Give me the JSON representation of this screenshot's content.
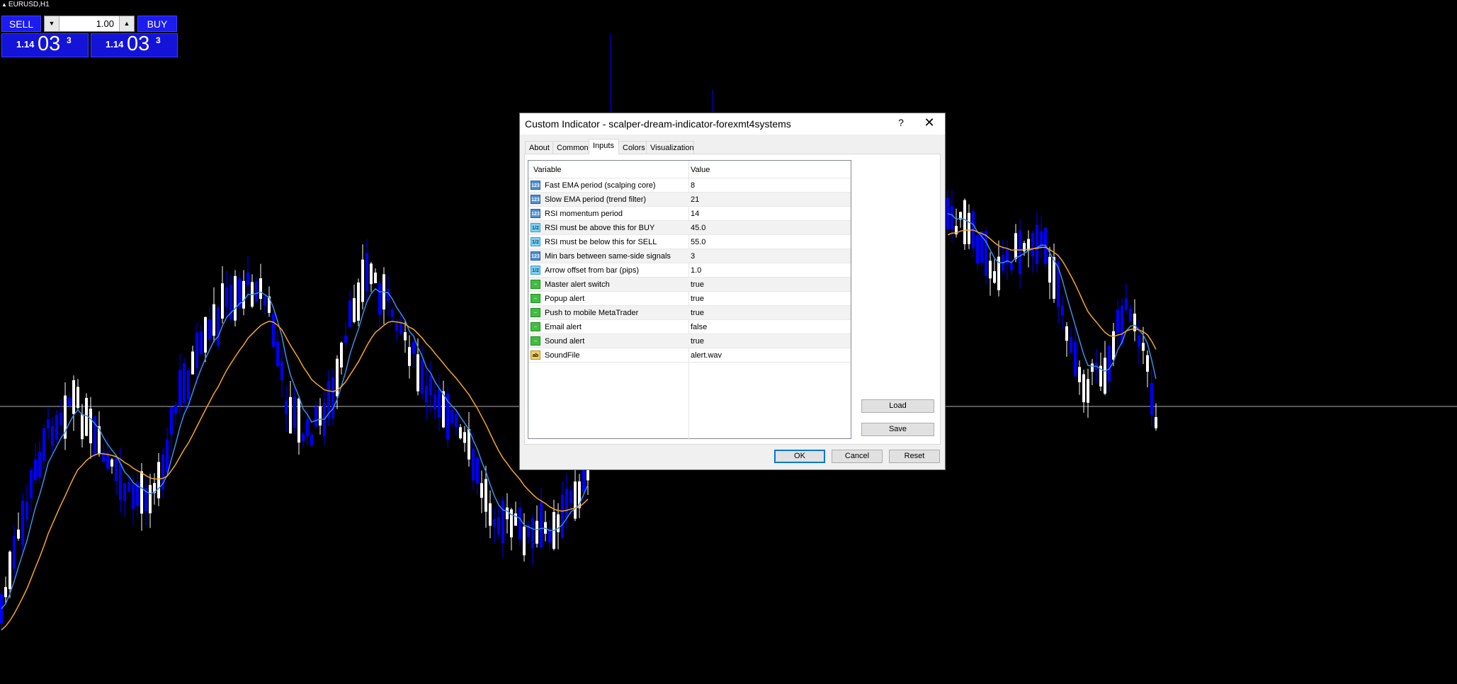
{
  "symbol": "EURUSD,H1",
  "trade_panel": {
    "sell_label": "SELL",
    "buy_label": "BUY",
    "lot": "1.00",
    "sell_price": {
      "big": "1.14",
      "mid": "03",
      "sup": "3"
    },
    "buy_price": {
      "big": "1.14",
      "mid": "03",
      "sup": "3"
    }
  },
  "dialog": {
    "title": "Custom Indicator - scalper-dream-indicator-forexmt4systems",
    "help": "?",
    "close": "✕",
    "tabs": [
      "About",
      "Common",
      "Inputs",
      "Colors",
      "Visualization"
    ],
    "active_tab": "Inputs",
    "columns": {
      "variable": "Variable",
      "value": "Value"
    },
    "inputs": [
      {
        "type": "int",
        "icon": "123",
        "variable": "Fast EMA period (scalping core)",
        "value": "8"
      },
      {
        "type": "int",
        "icon": "123",
        "variable": "Slow EMA period (trend filter)",
        "value": "21"
      },
      {
        "type": "int",
        "icon": "123",
        "variable": "RSI momentum period",
        "value": "14"
      },
      {
        "type": "double",
        "icon": "1/2",
        "variable": "RSI must be above this for BUY",
        "value": "45.0"
      },
      {
        "type": "double",
        "icon": "1/2",
        "variable": "RSI must be below this for SELL",
        "value": "55.0"
      },
      {
        "type": "int",
        "icon": "123",
        "variable": "Min bars between same-side signals",
        "value": "3"
      },
      {
        "type": "double",
        "icon": "1/2",
        "variable": "Arrow offset from bar (pips)",
        "value": "1.0"
      },
      {
        "type": "bool",
        "icon": "~",
        "variable": "Master alert switch",
        "value": "true"
      },
      {
        "type": "bool",
        "icon": "~",
        "variable": "Popup alert",
        "value": "true"
      },
      {
        "type": "bool",
        "icon": "~",
        "variable": "Push to mobile MetaTrader",
        "value": "true"
      },
      {
        "type": "bool",
        "icon": "~",
        "variable": "Email alert",
        "value": "false"
      },
      {
        "type": "bool",
        "icon": "~",
        "variable": "Sound alert",
        "value": "true"
      },
      {
        "type": "string",
        "icon": "ab",
        "variable": "SoundFile",
        "value": "alert.wav"
      }
    ],
    "load_label": "Load",
    "save_label": "Save",
    "ok_label": "OK",
    "cancel_label": "Cancel",
    "reset_label": "Reset"
  },
  "colors": {
    "background": "#000000",
    "bull_candle": "#ffffff",
    "bear_candle": "#0000ff",
    "fast_ema": "#3a8ee6",
    "slow_ema": "#f5a623",
    "price_line": "#b0b0b0",
    "button_blue": "#1c1cf0"
  }
}
